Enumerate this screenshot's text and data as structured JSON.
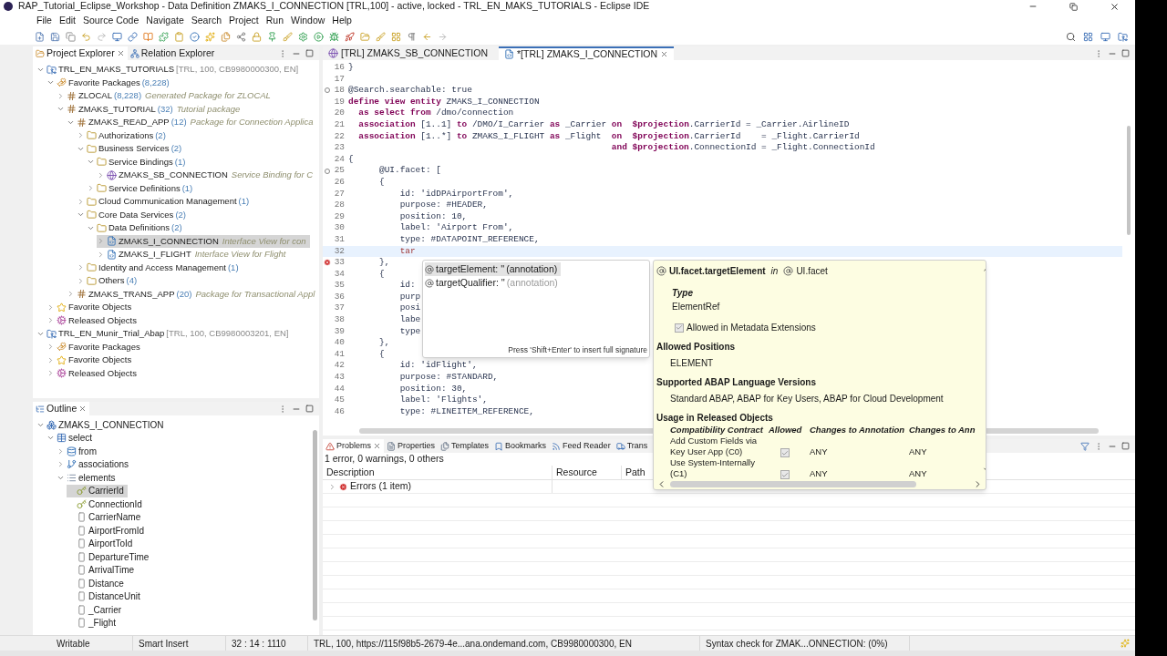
{
  "window": {
    "title": "RAP_Tutorial_Eclipse_Workshop - Data Definition ZMAKS_I_CONNECTION [TRL,100] - active, locked - TRL_EN_MAKS_TUTORIALS - Eclipse IDE"
  },
  "menu": [
    "File",
    "Edit",
    "Source Code",
    "Navigate",
    "Search",
    "Project",
    "Run",
    "Window",
    "Help"
  ],
  "project_explorer": {
    "tabs": [
      {
        "label": "Project Explorer",
        "selected": true
      },
      {
        "label": "Relation Explorer",
        "selected": false
      }
    ],
    "tree": [
      {
        "kind": "project",
        "label": "TRL_EN_MAKS_TUTORIALS",
        "info": "[TRL, 100, CB9980000300, EN]",
        "expanded": true,
        "selected": false,
        "children": [
          {
            "kind": "favorites",
            "label": "Favorite Packages",
            "count": "(8,228)",
            "expanded": true,
            "selected": false,
            "children": [
              {
                "kind": "package",
                "label": "ZLOCAL",
                "count": "(8,228)",
                "description": "Generated Package for ZLOCAL",
                "expanded": false,
                "selected": false
              },
              {
                "kind": "package",
                "label": "ZMAKS_TUTORIAL",
                "count": "(32)",
                "description": "Tutorial package",
                "expanded": true,
                "selected": false,
                "children": [
                  {
                    "kind": "package",
                    "label": "ZMAKS_READ_APP",
                    "count": "(12)",
                    "description": "Package for Connection Applica",
                    "expanded": true,
                    "selected": false,
                    "children": [
                      {
                        "kind": "folder",
                        "label": "Authorizations",
                        "count": "(2)",
                        "expanded": false,
                        "selected": false
                      },
                      {
                        "kind": "folder",
                        "label": "Business Services",
                        "count": "(2)",
                        "expanded": true,
                        "selected": false,
                        "children": [
                          {
                            "kind": "folder",
                            "label": "Service Bindings",
                            "count": "(1)",
                            "expanded": true,
                            "selected": false,
                            "children": [
                              {
                                "kind": "service-binding",
                                "label": "ZMAKS_SB_CONNECTION",
                                "description": "Service Binding for C",
                                "expanded": false,
                                "selected": false
                              }
                            ]
                          },
                          {
                            "kind": "folder",
                            "label": "Service Definitions",
                            "count": "(1)",
                            "expanded": false,
                            "selected": false
                          }
                        ]
                      },
                      {
                        "kind": "folder",
                        "label": "Cloud Communication Management",
                        "count": "(1)",
                        "expanded": false,
                        "selected": false
                      },
                      {
                        "kind": "folder",
                        "label": "Core Data Services",
                        "count": "(2)",
                        "expanded": true,
                        "selected": false,
                        "children": [
                          {
                            "kind": "folder",
                            "label": "Data Definitions",
                            "count": "(2)",
                            "expanded": true,
                            "selected": false,
                            "children": [
                              {
                                "kind": "ddl",
                                "label": "ZMAKS_I_CONNECTION",
                                "description": "Interface View for con",
                                "expanded": false,
                                "selected": true
                              },
                              {
                                "kind": "ddl",
                                "label": "ZMAKS_I_FLIGHT",
                                "description": "Interface View for Flight",
                                "expanded": false,
                                "selected": false
                              }
                            ]
                          }
                        ]
                      },
                      {
                        "kind": "folder",
                        "label": "Identity and Access Management",
                        "count": "(1)",
                        "expanded": false,
                        "selected": false
                      },
                      {
                        "kind": "folder",
                        "label": "Others",
                        "count": "(4)",
                        "expanded": false,
                        "selected": false
                      }
                    ]
                  },
                  {
                    "kind": "package",
                    "label": "ZMAKS_TRANS_APP",
                    "count": "(20)",
                    "description": "Package for Transactional Appl",
                    "expanded": false,
                    "selected": false
                  }
                ]
              }
            ]
          },
          {
            "kind": "star",
            "label": "Favorite Objects",
            "expanded": false,
            "selected": false
          },
          {
            "kind": "gear",
            "label": "Released Objects",
            "expanded": false,
            "selected": false
          }
        ]
      },
      {
        "kind": "project",
        "label": "TRL_EN_Munir_Trial_Abap",
        "info": "[TRL, 100, CB9980003201, EN]",
        "expanded": true,
        "selected": false,
        "children": [
          {
            "kind": "favorites",
            "label": "Favorite Packages",
            "expanded": false,
            "selected": false
          },
          {
            "kind": "star",
            "label": "Favorite Objects",
            "expanded": false,
            "selected": false
          },
          {
            "kind": "gear",
            "label": "Released Objects",
            "expanded": false,
            "selected": false
          }
        ]
      }
    ]
  },
  "outline": {
    "tabs": [
      {
        "label": "Outline",
        "selected": true
      }
    ],
    "tree": [
      {
        "kind": "entity",
        "label": "ZMAKS_I_CONNECTION",
        "expanded": true,
        "selected": false,
        "children": [
          {
            "kind": "select",
            "label": "select",
            "expanded": true,
            "selected": false,
            "children": [
              {
                "kind": "from",
                "label": "from",
                "expanded": false,
                "selected": false
              },
              {
                "kind": "associations",
                "label": "associations",
                "expanded": false,
                "selected": false
              },
              {
                "kind": "elements",
                "label": "elements",
                "expanded": true,
                "selected": false,
                "children": [
                  {
                    "kind": "key",
                    "label": "CarrierId",
                    "selected": true
                  },
                  {
                    "kind": "key",
                    "label": "ConnectionId",
                    "selected": false
                  },
                  {
                    "kind": "field",
                    "label": "CarrierName",
                    "selected": false
                  },
                  {
                    "kind": "field",
                    "label": "AirportFromId",
                    "selected": false
                  },
                  {
                    "kind": "field",
                    "label": "AirportToId",
                    "selected": false
                  },
                  {
                    "kind": "field",
                    "label": "DepartureTime",
                    "selected": false
                  },
                  {
                    "kind": "field",
                    "label": "ArrivalTime",
                    "selected": false
                  },
                  {
                    "kind": "field",
                    "label": "Distance",
                    "selected": false
                  },
                  {
                    "kind": "field",
                    "label": "DistanceUnit",
                    "selected": false
                  },
                  {
                    "kind": "field",
                    "label": "_Carrier",
                    "selected": false
                  },
                  {
                    "kind": "field",
                    "label": "_Flight",
                    "selected": false
                  }
                ]
              }
            ]
          }
        ]
      }
    ]
  },
  "editor": {
    "tabs": [
      {
        "label": "[TRL] ZMAKS_SB_CONNECTION",
        "selected": false
      },
      {
        "label": "*[TRL] ZMAKS_I_CONNECTION",
        "selected": true
      }
    ],
    "lines": [
      {
        "n": "16",
        "kind": "code",
        "current": false,
        "segs": [
          {
            "t": "}",
            "kind": "plain"
          }
        ]
      },
      {
        "n": "17",
        "kind": "code",
        "current": false
      },
      {
        "n": "18",
        "kind": "fold",
        "current": false,
        "segs": [
          {
            "t": "@Search.searchable: true",
            "kind": "plain"
          }
        ]
      },
      {
        "n": "19",
        "kind": "code",
        "current": false,
        "segs": [
          {
            "t": "define view entity",
            "kind": "keyword"
          },
          {
            "t": " ZMAKS_I_CONNECTION",
            "kind": "plain"
          }
        ]
      },
      {
        "n": "20",
        "kind": "code",
        "current": false,
        "segs": [
          {
            "t": "  as select from",
            "kind": "keyword"
          },
          {
            "t": " /dmo/connection",
            "kind": "plain"
          }
        ]
      },
      {
        "n": "21",
        "kind": "code",
        "current": false,
        "segs": [
          {
            "t": "  association",
            "kind": "keyword"
          },
          {
            "t": " [1..1] ",
            "kind": "plain"
          },
          {
            "t": "to",
            "kind": "keyword"
          },
          {
            "t": " /DMO/I_Carrier ",
            "kind": "plain"
          },
          {
            "t": "as",
            "kind": "keyword"
          },
          {
            "t": " _Carrier ",
            "kind": "plain"
          },
          {
            "t": "on  $projection",
            "kind": "keyword"
          },
          {
            "t": ".CarrierId = _Carrier.AirlineID",
            "kind": "plain"
          }
        ]
      },
      {
        "n": "22",
        "kind": "code",
        "current": false,
        "segs": [
          {
            "t": "  association",
            "kind": "keyword"
          },
          {
            "t": " [1..*] ",
            "kind": "plain"
          },
          {
            "t": "to",
            "kind": "keyword"
          },
          {
            "t": " ZMAKS_I_FLIGHT ",
            "kind": "plain"
          },
          {
            "t": "as",
            "kind": "keyword"
          },
          {
            "t": " _Flight  ",
            "kind": "plain"
          },
          {
            "t": "on  $projection",
            "kind": "keyword"
          },
          {
            "t": ".CarrierId    = _Flight.CarrierId",
            "kind": "plain"
          }
        ]
      },
      {
        "n": "23",
        "kind": "code",
        "current": false,
        "segs": [
          {
            "t": "                                                   and $projection",
            "kind": "keyword"
          },
          {
            "t": ".ConnectionId = _Flight.ConnectionId",
            "kind": "plain"
          }
        ]
      },
      {
        "n": "24",
        "kind": "code",
        "current": false,
        "segs": [
          {
            "t": "{",
            "kind": "plain"
          }
        ]
      },
      {
        "n": "25",
        "kind": "fold",
        "current": false,
        "segs": [
          {
            "t": "      @UI.facet: [",
            "kind": "plain"
          }
        ]
      },
      {
        "n": "26",
        "kind": "code",
        "current": false,
        "segs": [
          {
            "t": "      {",
            "kind": "plain"
          }
        ]
      },
      {
        "n": "27",
        "kind": "code",
        "current": false,
        "segs": [
          {
            "t": "          id: 'idDPAirportFrom',",
            "kind": "plain"
          }
        ]
      },
      {
        "n": "28",
        "kind": "code",
        "current": false,
        "segs": [
          {
            "t": "          purpose: #HEADER,",
            "kind": "plain"
          }
        ]
      },
      {
        "n": "29",
        "kind": "code",
        "current": false,
        "segs": [
          {
            "t": "          position: 10,",
            "kind": "plain"
          }
        ]
      },
      {
        "n": "30",
        "kind": "code",
        "current": false,
        "segs": [
          {
            "t": "          label: 'Airport From',",
            "kind": "plain"
          }
        ]
      },
      {
        "n": "31",
        "kind": "code",
        "current": false,
        "segs": [
          {
            "t": "          type: #DATAPOINT_REFERENCE,",
            "kind": "plain"
          }
        ]
      },
      {
        "n": "32",
        "kind": "code",
        "current": true,
        "segs": [
          {
            "t": "          tar",
            "kind": "error"
          }
        ]
      },
      {
        "n": "33",
        "kind": "error",
        "current": false,
        "segs": [
          {
            "t": "      },",
            "kind": "plain"
          }
        ]
      },
      {
        "n": "34",
        "kind": "code",
        "current": false,
        "segs": [
          {
            "t": "      {",
            "kind": "plain"
          }
        ]
      },
      {
        "n": "35",
        "kind": "code",
        "current": false,
        "segs": [
          {
            "t": "          id:",
            "kind": "plain"
          }
        ]
      },
      {
        "n": "36",
        "kind": "code",
        "current": false,
        "segs": [
          {
            "t": "          purp",
            "kind": "plain"
          }
        ]
      },
      {
        "n": "37",
        "kind": "code",
        "current": false,
        "segs": [
          {
            "t": "          posi",
            "kind": "plain"
          }
        ]
      },
      {
        "n": "38",
        "kind": "code",
        "current": false,
        "segs": [
          {
            "t": "          labe",
            "kind": "plain"
          }
        ]
      },
      {
        "n": "39",
        "kind": "code",
        "current": false,
        "segs": [
          {
            "t": "          type",
            "kind": "plain"
          }
        ]
      },
      {
        "n": "40",
        "kind": "code",
        "current": false,
        "segs": [
          {
            "t": "      },",
            "kind": "plain"
          }
        ]
      },
      {
        "n": "41",
        "kind": "code",
        "current": false,
        "segs": [
          {
            "t": "      {",
            "kind": "plain"
          }
        ]
      },
      {
        "n": "42",
        "kind": "code",
        "current": false,
        "segs": [
          {
            "t": "          id: 'idFlight',",
            "kind": "plain"
          }
        ]
      },
      {
        "n": "43",
        "kind": "code",
        "current": false,
        "segs": [
          {
            "t": "          purpose: #STANDARD,",
            "kind": "plain"
          }
        ]
      },
      {
        "n": "44",
        "kind": "code",
        "current": false,
        "segs": [
          {
            "t": "          position: 30,",
            "kind": "plain"
          }
        ]
      },
      {
        "n": "45",
        "kind": "code",
        "current": false,
        "segs": [
          {
            "t": "          label: 'Flights',",
            "kind": "plain"
          }
        ]
      },
      {
        "n": "46",
        "kind": "code",
        "current": false,
        "segs": [
          {
            "t": "          type: #LINEITEM_REFERENCE,",
            "kind": "plain"
          }
        ]
      }
    ]
  },
  "completion": {
    "items": [
      {
        "label": "targetElement: ''",
        "detail": "(annotation)",
        "selected": true
      },
      {
        "label": "targetQualifier: ''",
        "detail": "(annotation)",
        "selected": false
      }
    ],
    "hint": "Press 'Shift+Enter' to insert full signature"
  },
  "doc_popup": {
    "title": "UI.facet.targetElement",
    "connector": "in",
    "parent": "UI.facet",
    "type_label": "Type",
    "type_value": "ElementRef",
    "metadata_extensions": {
      "label": "Allowed in Metadata Extensions",
      "checked": true
    },
    "sections": [
      {
        "heading": "Allowed Positions",
        "text": "ELEMENT"
      },
      {
        "heading": "Supported ABAP Language Versions",
        "text": "Standard ABAP, ABAP for Key Users, ABAP for Cloud Development"
      },
      {
        "heading": "Usage in Released Objects"
      }
    ],
    "table": {
      "columns": [
        "Compatibility Contract",
        "Allowed",
        "Changes to Annotation",
        "Changes to Ann"
      ],
      "rows": [
        {
          "contract": "Add Custom Fields via Key User App (C0)",
          "allowed": true,
          "column_3": "ANY",
          "column_4": "ANY"
        },
        {
          "contract": "Use System-Internally (C1)",
          "allowed": true,
          "column_3": "ANY",
          "column_4": "ANY"
        }
      ]
    }
  },
  "bottom_panel": {
    "tabs": [
      {
        "label": "Problems",
        "selected": true
      },
      {
        "label": "Properties",
        "selected": false
      },
      {
        "label": "Templates",
        "selected": false
      },
      {
        "label": "Bookmarks",
        "selected": false
      },
      {
        "label": "Feed Reader",
        "selected": false
      },
      {
        "label": "Trans",
        "selected": false
      }
    ],
    "summary": "1 error, 0 warnings, 0 others",
    "columns": [
      "Description",
      "Resource",
      "Path"
    ],
    "rows": [
      {
        "label": "Errors (1 item)",
        "expanded": false
      }
    ]
  },
  "status_bar": [
    "Writable",
    "Smart Insert",
    "32 : 14 : 1110",
    "TRL, 100, https://115f98b5-2679-4e...ana.ondemand.com, CB9980000300, EN",
    "Syntax check for ZMAK...ONNECTION: (0%)"
  ]
}
